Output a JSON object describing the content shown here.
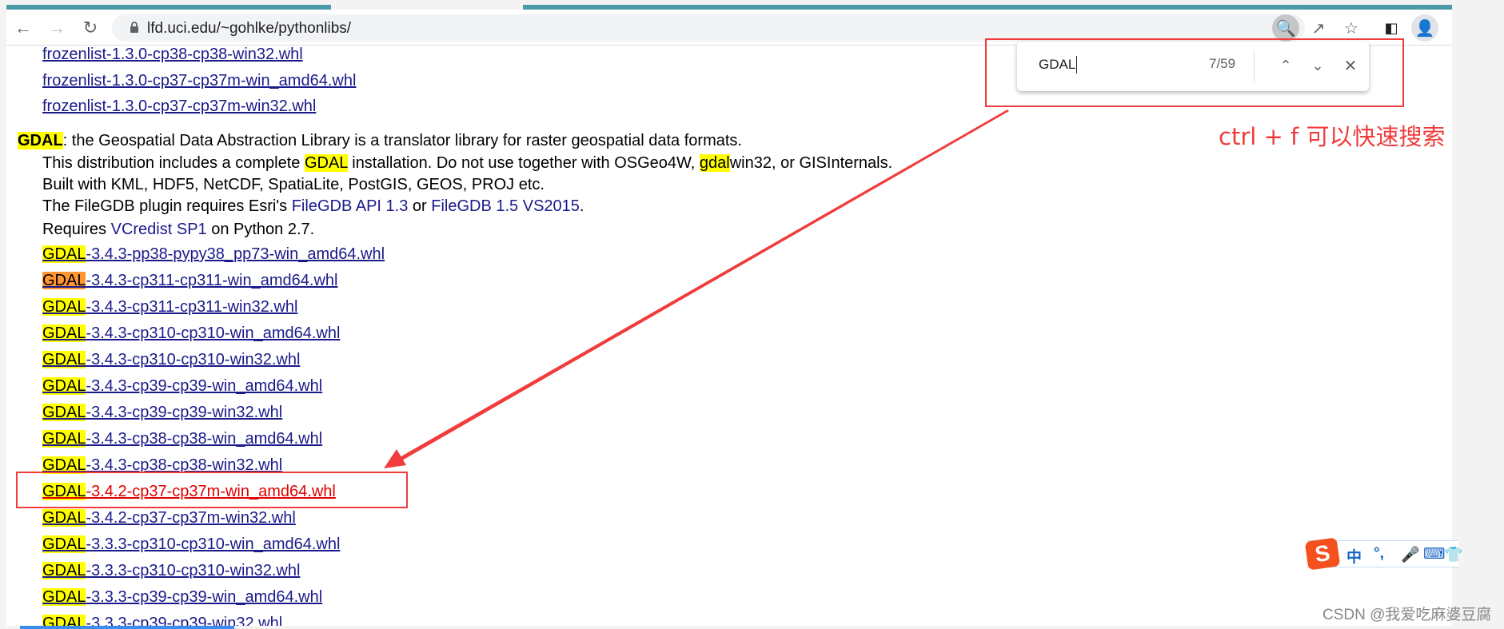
{
  "browser": {
    "url": "lfd.uci.edu/~gohlke/pythonlibs/",
    "icons": [
      "back-icon",
      "forward-icon",
      "reload-icon",
      "lock-icon",
      "find-icon",
      "share-icon",
      "star-icon",
      "side-panel-icon",
      "profile-icon"
    ]
  },
  "find_bar": {
    "query": "GDAL",
    "count": "7/59"
  },
  "annotation": "ctrl + f 可以快速搜索",
  "page": {
    "prev_links": [
      "frozenlist-1.3.0-cp38-cp38-win32.whl",
      "frozenlist-1.3.0-cp37-cp37m-win_amd64.whl",
      "frozenlist-1.3.0-cp37-cp37m-win32.whl"
    ],
    "gdal_name": "GDAL",
    "gdal_desc": ": the Geospatial Data Abstraction Library is a translator library for raster geospatial data formats.",
    "line2_a": "This distribution includes a complete ",
    "line2_hl": "GDAL",
    "line2_b": " installation. Do not use together with OSGeo4W, ",
    "line2_hl2": "gdal",
    "line2_c": "win32, or GISInternals.",
    "line3": "Built with KML, HDF5, NetCDF, SpatiaLite, PostGIS, GEOS, PROJ etc.",
    "line4_a": "The FileGDB plugin requires Esri's ",
    "line4_link1": "FileGDB API 1.3",
    "line4_b": " or ",
    "line4_link2": "FileGDB 1.5 VS2015",
    "line4_c": ".",
    "line5_a": "Requires ",
    "line5_link": "VCredist SP1",
    "line5_b": " on Python 2.7.",
    "prefix": "GDAL",
    "files": [
      "-3.4.3-pp38-pypy38_pp73-win_amd64.whl",
      "-3.4.3-cp311-cp311-win_amd64.whl",
      "-3.4.3-cp311-cp311-win32.whl",
      "-3.4.3-cp310-cp310-win_amd64.whl",
      "-3.4.3-cp310-cp310-win32.whl",
      "-3.4.3-cp39-cp39-win_amd64.whl",
      "-3.4.3-cp39-cp39-win32.whl",
      "-3.4.3-cp38-cp38-win_amd64.whl",
      "-3.4.3-cp38-cp38-win32.whl",
      "-3.4.2-cp37-cp37m-win_amd64.whl",
      "-3.4.2-cp37-cp37m-win32.whl",
      "-3.3.3-cp310-cp310-win_amd64.whl",
      "-3.3.3-cp310-cp310-win32.whl",
      "-3.3.3-cp39-cp39-win_amd64.whl",
      "-3.3.3-cp39-cp39-win32.whl"
    ],
    "active_match_index": 1,
    "highlighted_file_index": 9
  },
  "ime": {
    "lang": "中",
    "punct": "°,"
  },
  "watermark": "CSDN @我爱吃麻婆豆腐",
  "colors": {
    "link": "#1a1a8a",
    "match": "#ffff00",
    "active_match": "#ff9632",
    "annotation": "#f03c3c"
  }
}
